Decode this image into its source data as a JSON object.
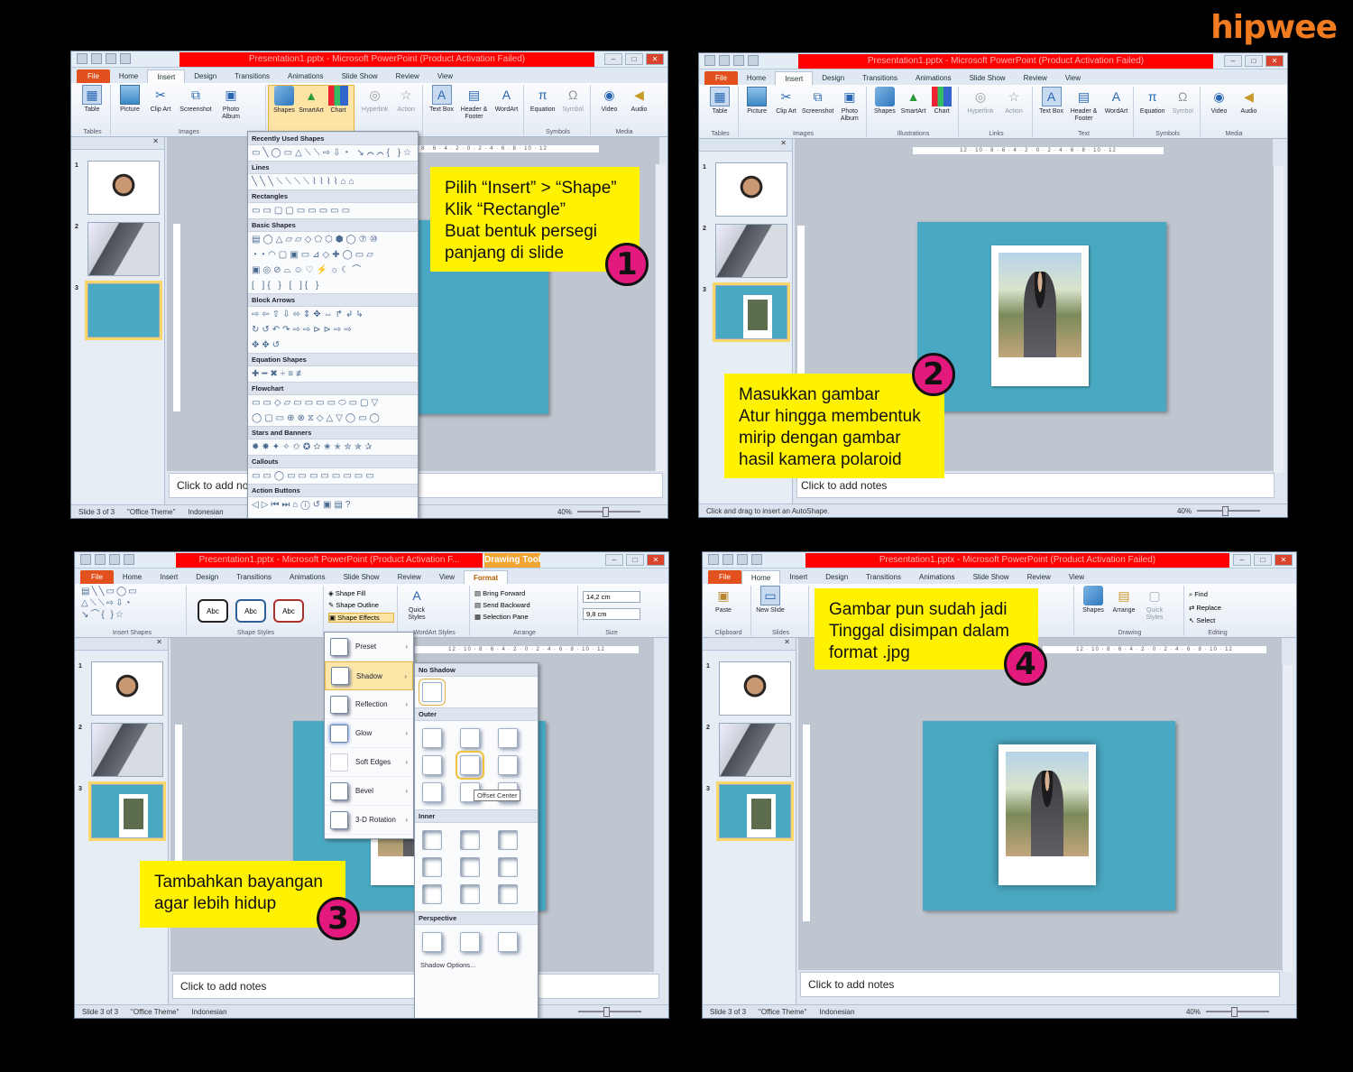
{
  "brand": {
    "logo": "hipwee"
  },
  "window_title": "Presentation1.pptx - Microsoft PowerPoint (Product Activation Failed)",
  "window_title_short": "Presentation1.pptx - Microsoft PowerPoint (Product Activation F...",
  "tabs": [
    "File",
    "Home",
    "Insert",
    "Design",
    "Transitions",
    "Animations",
    "Slide Show",
    "Review",
    "View"
  ],
  "drawing_tools": {
    "label": "Drawing Tools",
    "format_tab": "Format"
  },
  "insert_ribbon": {
    "buttons": [
      "Table",
      "Picture",
      "Clip Art",
      "Screenshot",
      "Photo Album",
      "Shapes",
      "SmartArt",
      "Chart",
      "Hyperlink",
      "Action",
      "Text Box",
      "Header & Footer",
      "WordArt",
      "Equation",
      "Symbol",
      "Video",
      "Audio"
    ],
    "groups": [
      "Tables",
      "Images",
      "Illustrations",
      "Links",
      "Text",
      "Symbols",
      "Media"
    ]
  },
  "home_ribbon": {
    "buttons": [
      "Paste",
      "New Slide",
      "Shapes",
      "Arrange",
      "Quick Styles",
      "Find",
      "Replace",
      "Select"
    ],
    "groups": [
      "Clipboard",
      "Slides",
      "Drawing",
      "Editing"
    ]
  },
  "format_ribbon": {
    "groups": [
      "Insert Shapes",
      "Shape Styles",
      "WordArt Styles",
      "Arrange",
      "Size"
    ],
    "style_samples": [
      "Abc",
      "Abc",
      "Abc"
    ],
    "shape_fill": "Shape Fill",
    "shape_outline": "Shape Outline",
    "shape_effects": "Shape Effects",
    "quick_styles": "Quick Styles",
    "bring_forward": "Bring Forward",
    "send_backward": "Send Backward",
    "selection_pane": "Selection Pane",
    "height": "14,2 cm",
    "width": "9,8 cm"
  },
  "ruler_text": "12 · 10 · 8 · 6 · 4 · 2 · 0 · 2 · 4 · 6 · 8 · 10 · 12",
  "shapes_menu": {
    "sections": [
      "Recently Used Shapes",
      "Lines",
      "Rectangles",
      "Basic Shapes",
      "Block Arrows",
      "Equation Shapes",
      "Flowchart",
      "Stars and Banners",
      "Callouts",
      "Action Buttons"
    ]
  },
  "effects_menu": {
    "items": [
      "Preset",
      "Shadow",
      "Reflection",
      "Glow",
      "Soft Edges",
      "Bevel",
      "3-D Rotation"
    ],
    "shadow": {
      "no_shadow": "No Shadow",
      "outer": "Outer",
      "inner": "Inner",
      "perspective": "Perspective",
      "options": "Shadow Options...",
      "tooltip": "Offset Center"
    }
  },
  "notes_placeholder": "Click to add notes",
  "notes_placeholder_cut": "Click to add no",
  "status": {
    "slide": "Slide 3 of 3",
    "theme": "\"Office Theme\"",
    "language": "Indonesian",
    "zoom": "40%",
    "hint": "Click and drag to insert an AutoShape."
  },
  "slide_numbers": [
    "1",
    "2",
    "3"
  ],
  "steps": [
    {
      "number": "1",
      "lines": [
        "Pilih “Insert” > “Shape”",
        "Klik “Rectangle”",
        "Buat bentuk persegi",
        "panjang di slide"
      ]
    },
    {
      "number": "2",
      "lines": [
        "Masukkan gambar",
        "Atur hingga membentuk",
        "mirip dengan gambar",
        "hasil kamera polaroid"
      ]
    },
    {
      "number": "3",
      "lines": [
        "Tambahkan bayangan",
        "agar lebih hidup"
      ]
    },
    {
      "number": "4",
      "lines": [
        "Gambar pun sudah jadi",
        "Tinggal disimpan dalam",
        "format .jpg"
      ]
    }
  ],
  "colors": {
    "background": "#000000",
    "brand_orange": "#f07b21",
    "callout": "#fff200",
    "badge": "#e4197d",
    "slide": "#4aa9c2",
    "title_red": "#ff0000",
    "file_tab": "#e1501d"
  }
}
